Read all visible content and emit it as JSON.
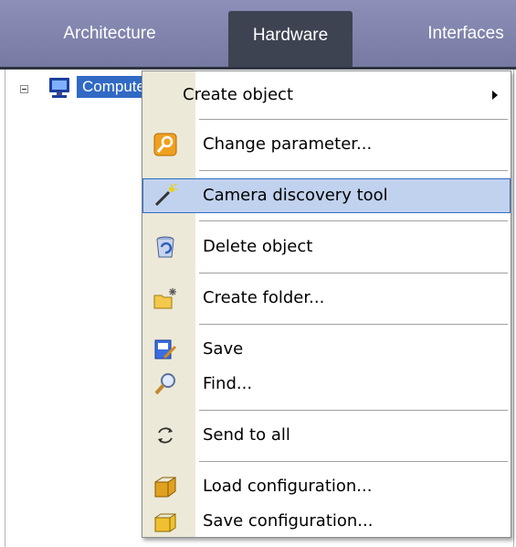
{
  "tabs": [
    {
      "label": "Architecture"
    },
    {
      "label": "Hardware"
    },
    {
      "label": "Interfaces"
    }
  ],
  "tree": {
    "root_label": "Computer",
    "expand_icon": "collapse-box-icon",
    "node_icon": "monitor-icon"
  },
  "menu": {
    "items": [
      {
        "label": "Create object",
        "icon": "none",
        "submenu": true
      },
      {
        "label": "Change parameter...",
        "icon": "wrench-settings-icon"
      },
      {
        "label": "Camera discovery tool",
        "icon": "discovery-wand-icon",
        "highlighted": true
      },
      {
        "label": "Delete object",
        "icon": "recycle-bin-icon"
      },
      {
        "label": "Create folder...",
        "icon": "new-folder-icon"
      },
      {
        "label": "Save",
        "icon": "save-edit-icon"
      },
      {
        "label": "Find...",
        "icon": "magnifier-icon"
      },
      {
        "label": "Send to all",
        "icon": "refresh-arrows-icon"
      },
      {
        "label": "Load configuration...",
        "icon": "load-box-icon"
      },
      {
        "label": "Save configuration...",
        "icon": "save-box-icon"
      }
    ]
  },
  "colors": {
    "tab_bar": "#8286ae",
    "tab_active": "#3e4352",
    "selection": "#316ac5",
    "menu_gutter": "#ece9d8",
    "menu_highlight": "#c1d2ee"
  }
}
